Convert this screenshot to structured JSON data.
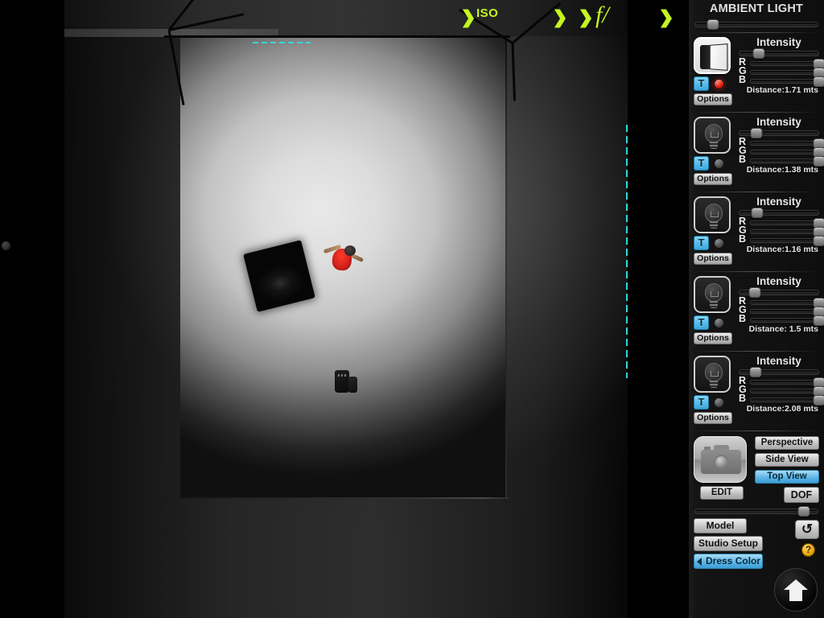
{
  "viewport": {
    "name": "studio-3d-viewport",
    "view_mode": "Top View",
    "scene_objects": [
      {
        "name": "softbox-light",
        "label": ""
      },
      {
        "name": "model-figure",
        "label": ""
      },
      {
        "name": "camera-object",
        "label": ""
      },
      {
        "name": "light-stand-left",
        "label": ""
      },
      {
        "name": "light-stand-right",
        "label": ""
      }
    ],
    "camera_labels": {
      "iso": "ISO",
      "fstop": "f/",
      "arrow_glyph": "❱"
    }
  },
  "panel": {
    "ambient": {
      "title": "AMBIENT LIGHT",
      "slider_value": 15
    },
    "labels": {
      "intensity": "Intensity",
      "options": "Options",
      "t_button": "T",
      "r": "R",
      "g": "G",
      "b": "B"
    },
    "lights": [
      {
        "type": "softbox",
        "icon": "softbox-icon",
        "active": true,
        "intensity": 25,
        "r": 100,
        "g": 100,
        "b": 100,
        "distance": "Distance:1.71 mts"
      },
      {
        "type": "bulb",
        "icon": "bulb-icon",
        "active": false,
        "intensity": 22,
        "r": 100,
        "g": 100,
        "b": 100,
        "distance": "Distance:1.38 mts"
      },
      {
        "type": "bulb",
        "icon": "bulb-icon",
        "active": false,
        "intensity": 23,
        "r": 100,
        "g": 100,
        "b": 100,
        "distance": "Distance:1.16 mts"
      },
      {
        "type": "bulb",
        "icon": "bulb-icon",
        "active": false,
        "intensity": 20,
        "r": 100,
        "g": 100,
        "b": 100,
        "distance": "Distance: 1.5 mts"
      },
      {
        "type": "bulb",
        "icon": "bulb-icon",
        "active": false,
        "intensity": 21,
        "r": 100,
        "g": 100,
        "b": 100,
        "distance": "Distance:2.08 mts"
      }
    ],
    "camera": {
      "icon": "camera-icon",
      "edit_label": "EDIT",
      "views": [
        {
          "label": "Perspective",
          "active": false
        },
        {
          "label": "Side View",
          "active": false
        },
        {
          "label": "Top View",
          "active": true
        }
      ],
      "dof_label": "DOF",
      "focus_slider_value": 88
    },
    "bottom": {
      "model_label": "Model",
      "studio_label": "Studio Setup",
      "dress_label": "Dress Color",
      "undo_glyph": "↺",
      "help_glyph": "?",
      "home_icon": "home-icon"
    },
    "colors": {
      "accent_blue": "#5fb6e6",
      "led_on": "#e01f12",
      "help_yellow": "#e8a50d",
      "guide_cyan": "#35d6dd",
      "camera_label": "#c4f521"
    }
  }
}
